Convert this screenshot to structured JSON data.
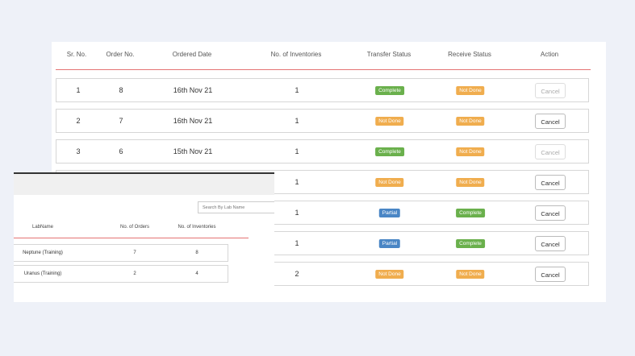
{
  "orders_table": {
    "headers": [
      "Sr. No.",
      "Order No.",
      "Ordered Date",
      "No. of Inventories",
      "Transfer Status",
      "Receive Status",
      "Action"
    ],
    "rows": [
      {
        "sr": "1",
        "order": "8",
        "date": "16th Nov 21",
        "inventories": "1",
        "transfer": "Complete",
        "receive": "Not Done",
        "action": "Cancel"
      },
      {
        "sr": "2",
        "order": "7",
        "date": "16th Nov 21",
        "inventories": "1",
        "transfer": "Not Done",
        "receive": "Not Done",
        "action": "Cancel"
      },
      {
        "sr": "3",
        "order": "6",
        "date": "15th Nov 21",
        "inventories": "1",
        "transfer": "Complete",
        "receive": "Not Done",
        "action": "Cancel"
      },
      {
        "inventories": "1",
        "transfer": "Not Done",
        "receive": "Not Done",
        "action": "Cancel"
      },
      {
        "inventories": "1",
        "transfer": "Partial",
        "receive": "Complete",
        "action": "Cancel"
      },
      {
        "inventories": "1",
        "transfer": "Partial",
        "receive": "Complete",
        "action": "Cancel"
      },
      {
        "inventories": "2",
        "transfer": "Not Done",
        "receive": "Not Done",
        "action": "Cancel"
      }
    ]
  },
  "lab_panel": {
    "search_placeholder": "Search By Lab Name",
    "headers": [
      "LabName",
      "No. of Orders",
      "No. of Inventories"
    ],
    "rows": [
      {
        "name": "Neptune (Training)",
        "orders": "7",
        "inventories": "8"
      },
      {
        "name": "Uranus (Training)",
        "orders": "2",
        "inventories": "4"
      }
    ]
  },
  "colors": {
    "complete": "#6ab04c",
    "not_done": "#f0ad4e",
    "partial": "#4a86c5",
    "divider": "#e57373"
  }
}
